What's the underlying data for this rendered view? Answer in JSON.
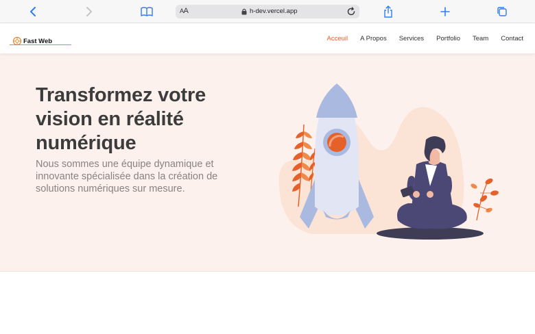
{
  "browser": {
    "url": "h-dev.vercel.app",
    "reader_label_small": "A",
    "reader_label_big": "A",
    "icons": [
      "back-icon",
      "forward-icon",
      "bookmarks-icon",
      "lock-icon",
      "reload-icon",
      "share-icon",
      "new-tab-icon",
      "tabs-icon"
    ]
  },
  "header": {
    "logo_text": "Fast Web",
    "nav": [
      {
        "label": "Acceuil",
        "active": true
      },
      {
        "label": "A Propos",
        "active": false
      },
      {
        "label": "Services",
        "active": false
      },
      {
        "label": "Portfolio",
        "active": false
      },
      {
        "label": "Team",
        "active": false
      },
      {
        "label": "Contact",
        "active": false
      }
    ]
  },
  "hero": {
    "title": "Transformez votre vision en réalité numérique",
    "subtitle": "Nous sommes une équipe dynamique et innovante spécialisée dans la création de solutions numériques sur mesure."
  },
  "colors": {
    "accent": "#e6612a",
    "hero_bg": "#fcf1ec",
    "title": "#3c3c3c",
    "subtitle": "#8a8280",
    "browser_blue": "#2e7cf6"
  }
}
